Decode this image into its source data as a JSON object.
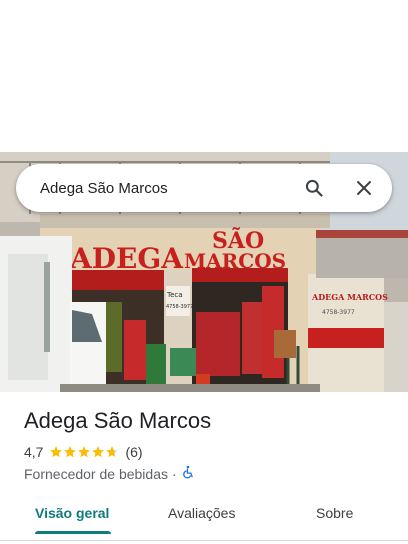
{
  "search": {
    "query": "Adega São Marcos"
  },
  "photo": {
    "sign_left": "ADEGA",
    "sign_right_line1": "SÃO",
    "sign_right_line2": "MARCOS",
    "wall_sign_line1": "ADEGA MARCOS",
    "wall_sign_line2": "4758-3977",
    "shop_board_line1": "Teca",
    "shop_board_line2": "4758-3977"
  },
  "place": {
    "name": "Adega São Marcos",
    "rating": "4,7",
    "rating_value": 4.7,
    "review_count": "(6)",
    "category": "Fornecedor de bebidas",
    "separator": "·",
    "accessibility_icon": "wheelchair-icon"
  },
  "tabs": [
    {
      "label": "Visão geral",
      "active": true
    },
    {
      "label": "Avaliações",
      "active": false
    },
    {
      "label": "Sobre",
      "active": false
    }
  ],
  "colors": {
    "accent": "#0f7b7a",
    "star": "#fbbc04",
    "accessibility_icon": "#1a73e8",
    "sign_red": "#c8201f"
  }
}
